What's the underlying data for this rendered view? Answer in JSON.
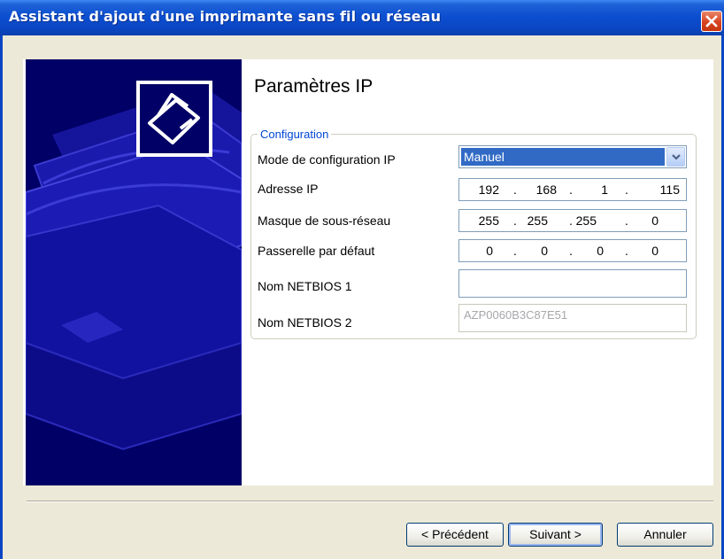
{
  "window": {
    "title": "Assistant d'ajout d'une imprimante sans fil ou réseau"
  },
  "page": {
    "heading": "Paramètres IP"
  },
  "group": {
    "legend": "Configuration"
  },
  "fields": {
    "ip_mode": {
      "label": "Mode de configuration IP",
      "value": "Manuel"
    },
    "ip_address": {
      "label": "Adresse IP",
      "octets": [
        "192",
        "168",
        "1",
        "115"
      ]
    },
    "subnet_mask": {
      "label": "Masque de sous-réseau",
      "octets": [
        "255",
        "255",
        "255",
        "0"
      ]
    },
    "gateway": {
      "label": "Passerelle par défaut",
      "octets": [
        "0",
        "0",
        "0",
        "0"
      ]
    },
    "netbios1": {
      "label": "Nom NETBIOS 1",
      "value": ""
    },
    "netbios2": {
      "label": "Nom NETBIOS 2",
      "value": "AZP0060B3C87E51"
    }
  },
  "buttons": {
    "back": "< Précédent",
    "next": "Suivant >",
    "cancel": "Annuler"
  },
  "icons": {
    "close": "close-icon",
    "printer": "printer-icon",
    "dropdown": "chevron-down-icon"
  },
  "colors": {
    "titlebar": "#0a46c4",
    "selection": "#316ac5",
    "legend": "#0046d5",
    "banner": "#000066"
  }
}
